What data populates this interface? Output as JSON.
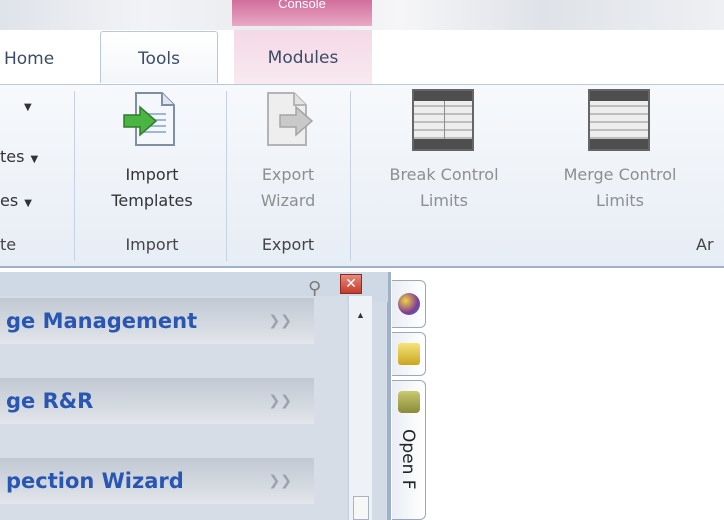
{
  "window": {
    "context_tab_header": "Console"
  },
  "tabs": [
    {
      "label": "Home"
    },
    {
      "label": "Tools"
    },
    {
      "label": "Modules"
    }
  ],
  "ribbon": {
    "partial_items": [
      {
        "label": "",
        "has_dropdown": true
      },
      {
        "label": "tes",
        "has_dropdown": true
      },
      {
        "label": "es",
        "has_dropdown": true
      }
    ],
    "partial_group_label": "te",
    "groups": [
      {
        "label": "Import",
        "buttons": [
          {
            "line1": "Import",
            "line2": "Templates",
            "icon": "import-templates-icon",
            "enabled": true
          }
        ]
      },
      {
        "label": "Export",
        "buttons": [
          {
            "line1": "Export",
            "line2": "Wizard",
            "icon": "export-wizard-icon",
            "enabled": false
          }
        ]
      },
      {
        "label": "Ar",
        "buttons": [
          {
            "line1": "Break Control",
            "line2": "Limits",
            "icon": "grid-icon",
            "enabled": false
          },
          {
            "line1": "Merge Control",
            "line2": "Limits",
            "icon": "grid-icon",
            "enabled": false
          }
        ]
      }
    ]
  },
  "nav_panel": {
    "items": [
      {
        "label": "ge Management"
      },
      {
        "label": "ge R&R"
      },
      {
        "label": "pection Wizard"
      }
    ]
  },
  "side_tabs": {
    "open_label": "Open F"
  },
  "colors": {
    "context_tab": "#d16e9c",
    "nav_item_text": "#2a56b3",
    "close_button": "#c43a2a",
    "ribbon_bg": "#eef2f8"
  }
}
